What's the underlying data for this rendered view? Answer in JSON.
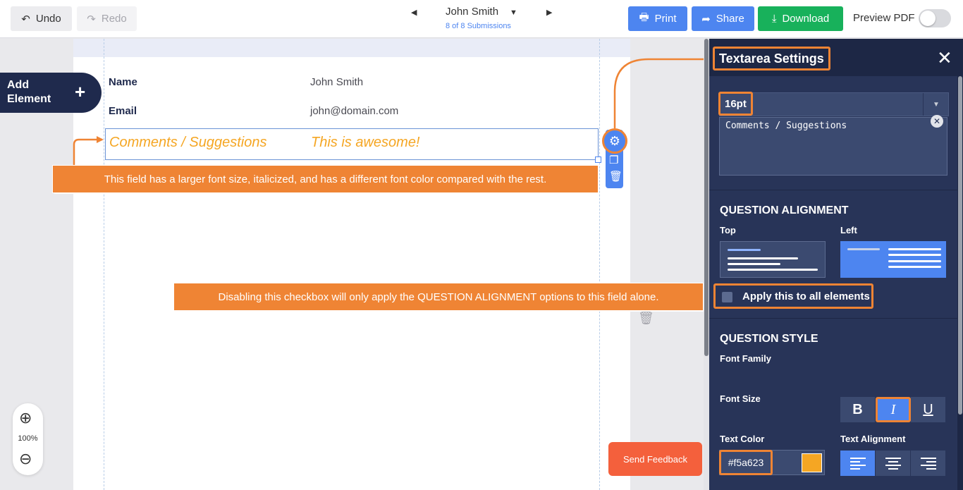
{
  "toolbar": {
    "undo_label": "Undo",
    "redo_label": "Redo",
    "print_label": "Print",
    "share_label": "Share",
    "download_label": "Download",
    "preview_pdf_label": "Preview PDF"
  },
  "submission": {
    "name": "John Smith",
    "count": "8 of 8 Submissions"
  },
  "left": {
    "add_element_label": "Add Element",
    "zoom_level": "100%"
  },
  "form": {
    "fields": [
      {
        "label": "Name",
        "value": "John Smith"
      },
      {
        "label": "Email",
        "value": "john@domain.com"
      },
      {
        "label": "Comments / Suggestions",
        "value": "This is awesome!"
      }
    ]
  },
  "callouts": {
    "field_note": "This field has a larger font size, italicized, and has a different font color compared with the rest.",
    "checkbox_note": "Disabling this checkbox will only apply the QUESTION ALIGNMENT options to this field alone."
  },
  "feedback_label": "Send Feedback",
  "panel": {
    "title": "Textarea Settings",
    "font_size_value": "16pt",
    "textarea_value": "Comments / Suggestions",
    "alignment_title": "QUESTION ALIGNMENT",
    "align_top_label": "Top",
    "align_left_label": "Left",
    "apply_all_label": "Apply this to all elements",
    "style_title": "QUESTION STYLE",
    "font_family_label": "Font Family",
    "font_size_label": "Font Size",
    "text_color_label": "Text Color",
    "text_alignment_label": "Text Alignment",
    "text_color_value": "#f5a623",
    "bold_glyph": "B",
    "italic_glyph": "I",
    "underline_glyph": "U"
  },
  "colors": {
    "accent_orange": "#ef8434",
    "primary_blue": "#4d85f0",
    "download_green": "#18b15b",
    "panel_bg": "#283458",
    "field_text_color": "#f5a623",
    "feedback_red": "#f4603c"
  },
  "icons": [
    "undo-icon",
    "redo-icon",
    "print-icon",
    "share-icon",
    "download-icon",
    "gear-icon",
    "copy-icon",
    "trash-icon",
    "close-icon",
    "zoom-in-icon",
    "zoom-out-icon",
    "plus-icon"
  ]
}
